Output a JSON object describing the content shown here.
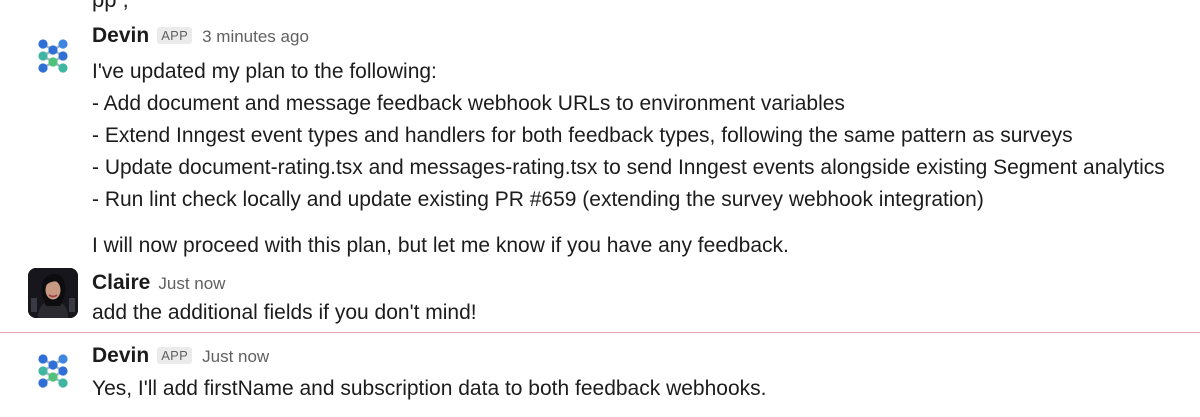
{
  "previous_message": {
    "cutoff_text": "pp                                          ,"
  },
  "messages": [
    {
      "author": "Devin",
      "badge": "APP",
      "timestamp": "3 minutes ago",
      "avatar_icon": "devin-logo-icon",
      "intro": "I've updated my plan to the following:",
      "plan_items": [
        "- Add document and message feedback webhook URLs to environment variables",
        "- Extend Inngest event types and handlers for both feedback types, following the same pattern as surveys",
        "- Update document-rating.tsx and messages-rating.tsx to send Inngest events alongside existing Segment analytics",
        "- Run lint check locally and update existing PR #659 (extending the survey webhook integration)"
      ],
      "closing": "I will now proceed with this plan, but let me know if you have any feedback."
    },
    {
      "author": "Claire",
      "timestamp": "Just now",
      "avatar_icon": "user-photo-avatar",
      "text": "add the additional fields if you don't mind!"
    },
    {
      "author": "Devin",
      "badge": "APP",
      "timestamp": "Just now",
      "avatar_icon": "devin-logo-icon",
      "text": "Yes, I'll add firstName and subscription data to both feedback webhooks."
    }
  ],
  "colors": {
    "divider": "#e8a3b3",
    "logo_blue": "#2f6fd6",
    "logo_teal": "#3fb7a0",
    "logo_green": "#4fc27a"
  }
}
